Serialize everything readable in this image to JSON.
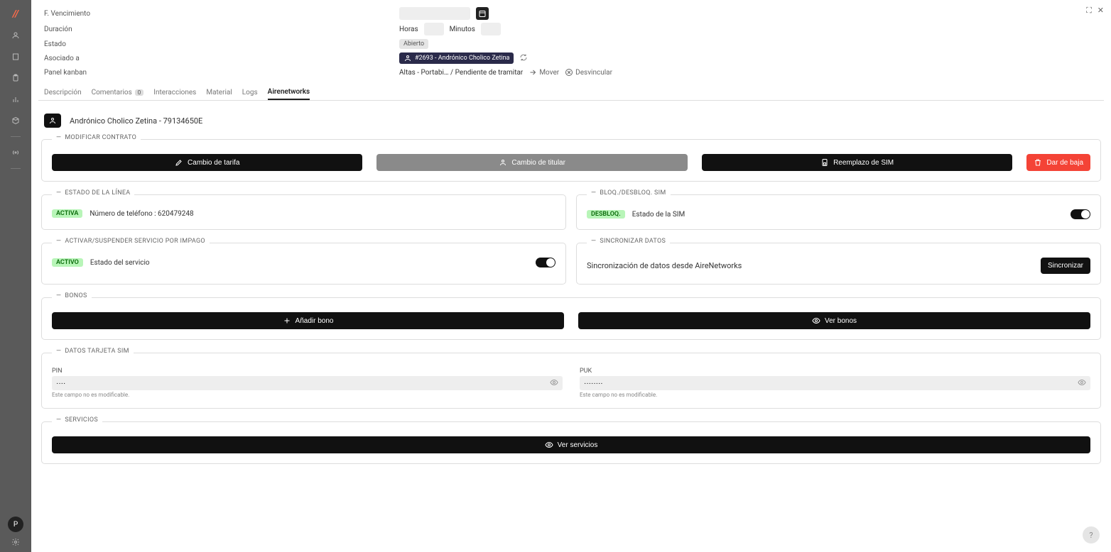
{
  "sidebar": {
    "logo": "//",
    "avatar_letter": "P"
  },
  "win": {
    "expand": "⛶",
    "close": "✕"
  },
  "form": {
    "vencimiento_label": "F. Vencimiento",
    "duracion_label": "Duración",
    "horas_label": "Horas",
    "minutos_label": "Minutos",
    "estado_label": "Estado",
    "estado_value": "Abierto",
    "asociado_label": "Asociado a",
    "asociado_chip": "#2693 - Andrónico Cholico Zetina",
    "kanban_label": "Panel kanban",
    "kanban_value": "Altas - Portabi… / Pendiente de tramitar",
    "mover": "Mover",
    "desvincular": "Desvincular"
  },
  "tabs": {
    "descripcion": "Descripción",
    "comentarios": "Comentarios",
    "comentarios_count": "0",
    "interacciones": "Interacciones",
    "material": "Material",
    "logs": "Logs",
    "airenetworks": "Airenetworks"
  },
  "customer": {
    "name": "Andrónico Cholico Zetina - 79134650E"
  },
  "cards": {
    "modificar": {
      "title": "MODIFICAR CONTRATO",
      "cambio_tarifa": "Cambio de tarifa",
      "cambio_titular": "Cambio de titular",
      "reemplazo_sim": "Reemplazo de SIM",
      "dar_baja": "Dar de baja"
    },
    "estado_linea": {
      "title": "ESTADO DE LA LÍNEA",
      "badge": "ACTIVA",
      "text": "Número de teléfono : 620479248"
    },
    "bloq": {
      "title": "BLOQ./DESBLOQ. SIM",
      "badge": "DESBLOQ.",
      "text": "Estado de la SIM"
    },
    "suspender": {
      "title": "ACTIVAR/SUSPENDER SERVICIO POR IMPAGO",
      "badge": "ACTIVO",
      "text": "Estado del servicio"
    },
    "sync": {
      "title": "SINCRONIZAR DATOS",
      "text": "Sincronización de datos desde AireNetworks",
      "btn": "Sincronizar"
    },
    "bonos": {
      "title": "BONOS",
      "add": "Añadir bono",
      "view": "Ver bonos"
    },
    "sim": {
      "title": "DATOS TARJETA SIM",
      "pin_label": "PIN",
      "pin_value": "····",
      "puk_label": "PUK",
      "puk_value": "········",
      "hint": "Este campo no es modificable."
    },
    "servicios": {
      "title": "SERVICIOS",
      "btn": "Ver servicios"
    }
  },
  "help": "?"
}
